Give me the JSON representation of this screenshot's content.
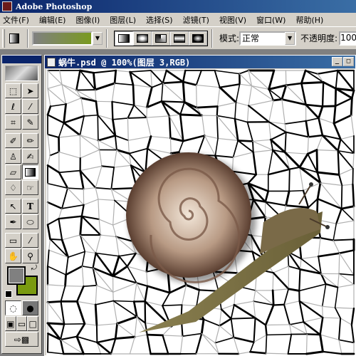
{
  "app": {
    "title": "Adobe Photoshop"
  },
  "menu": [
    "文件(F)",
    "编辑(E)",
    "图像(I)",
    "图层(L)",
    "选择(S)",
    "滤镜(T)",
    "视图(V)",
    "窗口(W)",
    "帮助(H)"
  ],
  "options": {
    "mode_label": "模式:",
    "mode_value": "正常",
    "opacity_label": "不透明度:",
    "opacity_value": "100",
    "gradient_colors": [
      "#808080",
      "#7a9a20"
    ],
    "gradient_types": [
      "linear",
      "radial",
      "angle",
      "reflected",
      "diamond"
    ],
    "active_type": "linear"
  },
  "toolbox": {
    "foreground": "#808080",
    "background": "#7a9a10",
    "tools": [
      [
        "marquee",
        "move"
      ],
      [
        "lasso",
        "magic-wand"
      ],
      [
        "crop",
        "slice"
      ],
      [
        "healing-brush",
        "brush"
      ],
      [
        "clone-stamp",
        "history-brush"
      ],
      [
        "eraser",
        "gradient"
      ],
      [
        "blur",
        "dodge"
      ],
      [
        "path-select",
        "type"
      ],
      [
        "pen",
        "ellipse"
      ],
      [
        "notes",
        "eyedropper"
      ],
      [
        "hand",
        "zoom"
      ]
    ],
    "active_tool": "gradient"
  },
  "document": {
    "title": "蜗牛.psd @ 100%(图层 3,RGB)"
  }
}
